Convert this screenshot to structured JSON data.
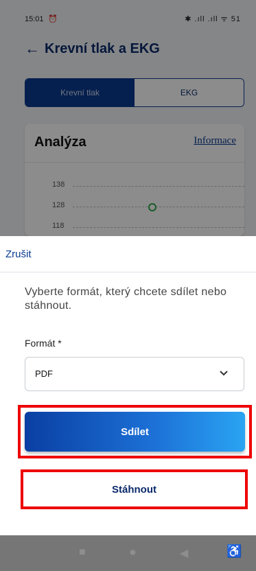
{
  "status_bar": {
    "time": "15:01",
    "alarm_icon": "alarm-clock-icon",
    "icons_text": "✱ .ıll .ıll ᯤ 51"
  },
  "header": {
    "title": "Krevní tlak a EKG",
    "back_icon": "arrow-left-icon"
  },
  "tabs": [
    {
      "label": "Krevní tlak",
      "active": true
    },
    {
      "label": "EKG",
      "active": false
    }
  ],
  "analysis": {
    "title": "Analýza",
    "info_link": "Informace",
    "y_ticks": [
      "138",
      "128",
      "118"
    ],
    "point_value": 128
  },
  "sheet": {
    "cancel_label": "Zrušit",
    "instruction": "Vyberte formát, který chcete sdílet nebo stáhnout.",
    "format_label": "Formát *",
    "format_value": "PDF",
    "share_label": "Sdílet",
    "download_label": "Stáhnout"
  },
  "nav_bar": {
    "icons": [
      "recent-apps-icon",
      "home-icon",
      "back-triangle-icon",
      "accessibility-icon"
    ]
  },
  "colors": {
    "accent": "#0a3a8f",
    "highlight": "#ee0000",
    "point": "#2aa84a"
  }
}
